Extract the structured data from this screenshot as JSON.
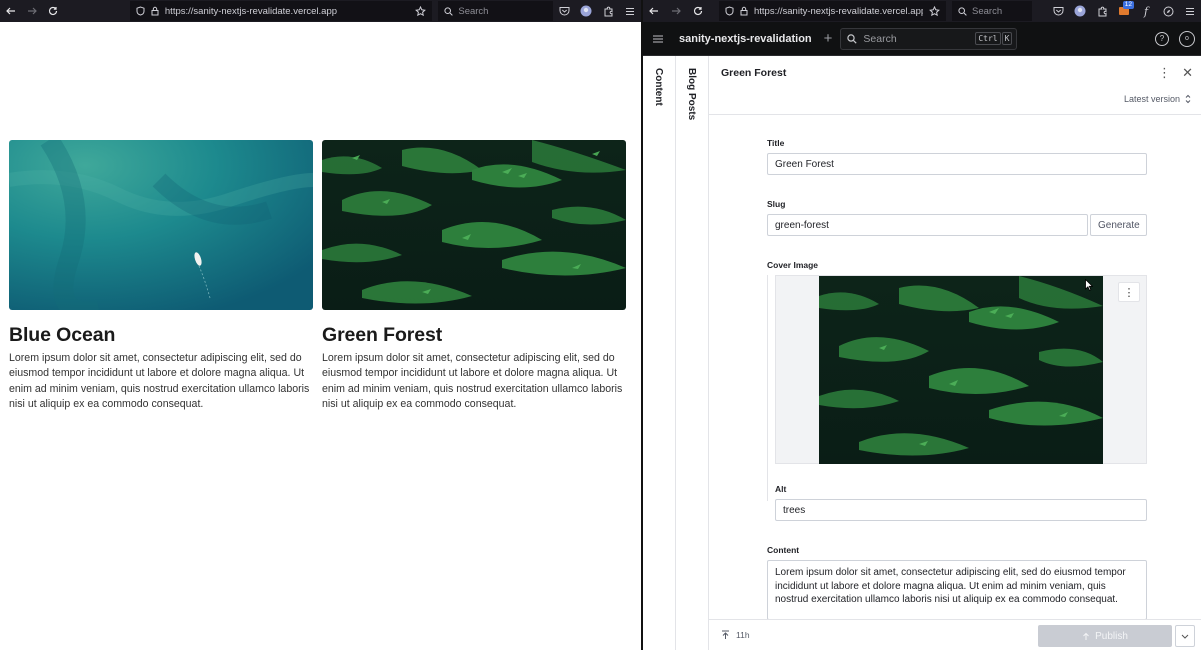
{
  "left_browser": {
    "url": "https://sanity-nextjs-revalidate.vercel.app",
    "search_placeholder": "Search"
  },
  "right_browser": {
    "url": "https://sanity-nextjs-revalidate.vercel.app/st",
    "search_placeholder": "Search",
    "badge_count": "12"
  },
  "site": {
    "posts": [
      {
        "title": "Blue Ocean",
        "body": "Lorem ipsum dolor sit amet, consectetur adipiscing elit, sed do eiusmod tempor incididunt ut labore et dolore magna aliqua. Ut enim ad minim veniam, quis nostrud exercitation ullamco laboris nisi ut aliquip ex ea commodo consequat.",
        "image": "aerial-ocean-with-boat"
      },
      {
        "title": "Green Forest",
        "body": "Lorem ipsum dolor sit amet, consectetur adipiscing elit, sed do eiusmod tempor incididunt ut labore et dolore magna aliqua. Ut enim ad minim veniam, quis nostrud exercitation ullamco laboris nisi ut aliquip ex ea commodo consequat.",
        "image": "green-fern-trees"
      }
    ]
  },
  "studio": {
    "project_name": "sanity-nextjs-revalidation",
    "search_placeholder": "Search",
    "kbd": [
      "Ctrl",
      "K"
    ],
    "avatar_initial": "o",
    "rail_content": "Content",
    "rail_blog_posts": "Blog Posts",
    "document": {
      "title": "Green Forest",
      "version_label": "Latest version",
      "fields": {
        "title_label": "Title",
        "title_value": "Green Forest",
        "slug_label": "Slug",
        "slug_value": "green-forest",
        "generate_label": "Generate",
        "cover_label": "Cover Image",
        "alt_label": "Alt",
        "alt_value": "trees",
        "content_label": "Content",
        "content_value": "Lorem ipsum dolor sit amet, consectetur adipiscing elit, sed do eiusmod tempor incididunt ut labore et dolore magna aliqua. Ut enim ad minim veniam, quis nostrud exercitation ullamco laboris nisi ut aliquip ex ea commodo consequat."
      },
      "footer": {
        "status": "11h",
        "publish_label": "Publish"
      }
    }
  }
}
